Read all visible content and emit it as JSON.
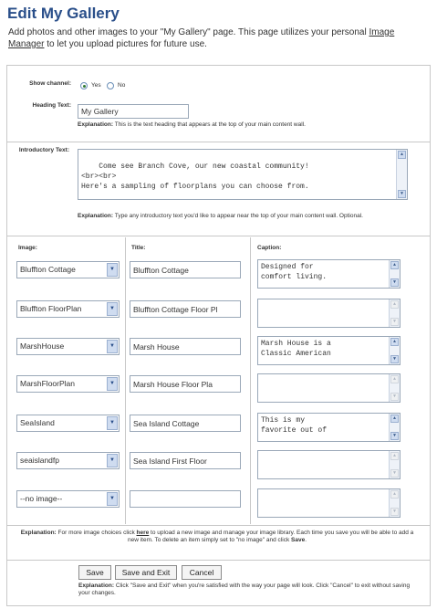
{
  "page": {
    "title": "Edit My Gallery",
    "intro_before_link": "Add photos and other images to your \"My Gallery\" page. This page utilizes your personal ",
    "intro_link": "Image Manager",
    "intro_after_link": " to let you upload pictures for future use."
  },
  "form": {
    "show_channel": {
      "label": "Show channel:",
      "yes": "Yes",
      "no": "No",
      "selected": "Yes"
    },
    "heading": {
      "label": "Heading Text:",
      "value": "My Gallery",
      "explanation_label": "Explanation:",
      "explanation_text": "This is the text heading that appears at the top of your main content wall."
    },
    "intro_text": {
      "label": "Introductory Text:",
      "value": "Come see Branch Cove, our new coastal community!\n<br><br>\nHere's a sampling of floorplans you can choose from.",
      "explanation_label": "Explanation:",
      "explanation_text": "Type any introductory text you'd like to appear near the top of your main content wall. Optional."
    },
    "columns": {
      "image": "Image:",
      "title": "Title:",
      "caption": "Caption:"
    },
    "rows": [
      {
        "image": "Bluffton Cottage",
        "title": "Bluffton Cottage",
        "caption": "Designed for\ncomfort living."
      },
      {
        "image": "Bluffton FloorPlan",
        "title": "Bluffton Cottage Floor Pl",
        "caption": ""
      },
      {
        "image": "MarshHouse",
        "title": "Marsh House",
        "caption": "Marsh House is a\nClassic American"
      },
      {
        "image": "MarshFloorPlan",
        "title": "Marsh House Floor Pla",
        "caption": ""
      },
      {
        "image": "SeaIsland",
        "title": "Sea Island Cottage",
        "caption": "This is my\nfavorite out of"
      },
      {
        "image": "seaislandfp",
        "title": "Sea Island First Floor",
        "caption": ""
      },
      {
        "image": "--no image--",
        "title": "",
        "caption": ""
      }
    ],
    "bottom_explanation": {
      "label": "Explanation:",
      "text1": " For more image choices click ",
      "link": "here",
      "text2": " to upload a new image and manage your image library. Each time you save you will be able to add a new item. To delete an item simply set to \"no image\" and click ",
      "save_word": "Save",
      "end": "."
    },
    "buttons": {
      "save": "Save",
      "save_exit": "Save and Exit",
      "cancel": "Cancel"
    },
    "button_explanation": {
      "label": "Explanation:",
      "text": " Click \"Save and Exit\" when you're satisfied with the way your page will look. Click \"Cancel\" to exit without saving your changes."
    }
  }
}
